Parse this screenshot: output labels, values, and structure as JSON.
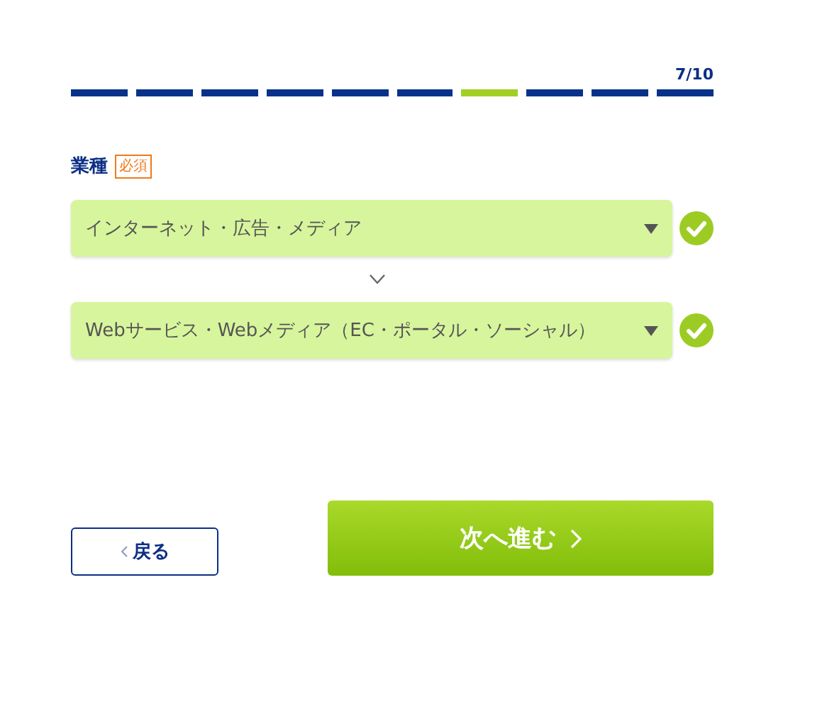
{
  "progress": {
    "counter": "7/10",
    "steps": [
      {
        "selected": false
      },
      {
        "selected": false
      },
      {
        "selected": false
      },
      {
        "selected": false
      },
      {
        "selected": false
      },
      {
        "selected": false
      },
      {
        "selected": true
      },
      {
        "selected": false
      },
      {
        "selected": false
      },
      {
        "selected": false
      }
    ]
  },
  "field": {
    "label": "業種",
    "badge": "必須"
  },
  "selects": [
    {
      "value": "インターネット・広告・メディア",
      "valid": true
    },
    {
      "value": "Webサービス・Webメディア（EC・ポータル・ソーシャル）",
      "valid": true
    }
  ],
  "buttons": {
    "back": "戻る",
    "next": "次へ進む"
  }
}
